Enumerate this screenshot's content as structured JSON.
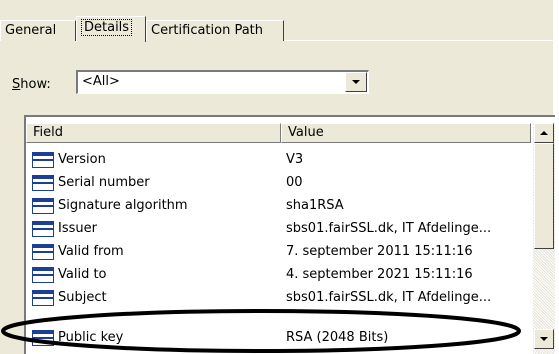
{
  "tabs": [
    {
      "label": "General"
    },
    {
      "label": "Details"
    },
    {
      "label": "Certification Path"
    }
  ],
  "show": {
    "label_prefix": "S",
    "label_rest": "how:",
    "selected": "<All>"
  },
  "list": {
    "columns": [
      "Field",
      "Value"
    ],
    "rows": [
      {
        "field": "Version",
        "value": "V3"
      },
      {
        "field": "Serial number",
        "value": "00"
      },
      {
        "field": "Signature algorithm",
        "value": "sha1RSA"
      },
      {
        "field": "Issuer",
        "value": "sbs01.fairSSL.dk, IT Afdelinge..."
      },
      {
        "field": "Valid from",
        "value": "7. september 2011 15:11:16"
      },
      {
        "field": "Valid to",
        "value": "4. september 2021 15:11:16"
      },
      {
        "field": "Subject",
        "value": "sbs01.fairSSL.dk, IT Afdelinge..."
      },
      {
        "field": "Public key",
        "value": "RSA (2048 Bits)"
      }
    ]
  },
  "colors": {
    "dialog_bg": "#ece9d8",
    "icon_blue": "#1c3f94",
    "annotation": "#000000"
  }
}
